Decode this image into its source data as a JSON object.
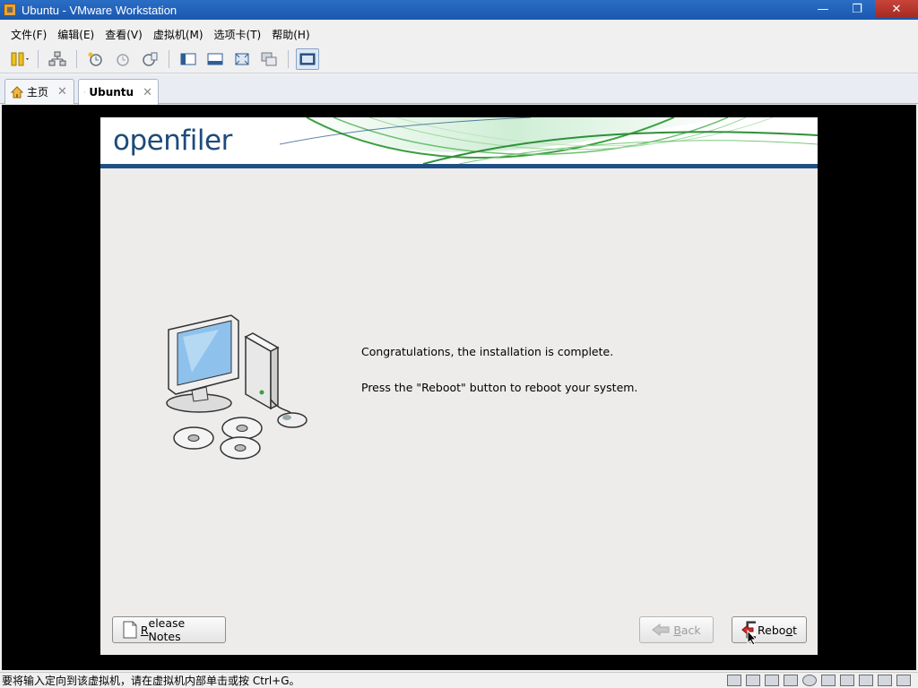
{
  "window": {
    "title": "Ubuntu - VMware Workstation",
    "controls": [
      "minimize-icon",
      "restore-icon",
      "close-icon"
    ]
  },
  "menu": [
    "文件(F)",
    "编辑(E)",
    "查看(V)",
    "虚拟机(M)",
    "选项卡(T)",
    "帮助(H)"
  ],
  "tabs": [
    {
      "label": "主页",
      "icon": "home-icon",
      "active": false
    },
    {
      "label": "Ubuntu",
      "icon": "vm-running-icon",
      "active": true
    }
  ],
  "installer": {
    "logo": "openfiler",
    "message_line1": "Congratulations, the installation is complete.",
    "message_line2": "Press the \"Reboot\" button to reboot your system.",
    "buttons": {
      "release_notes_mnemonic": "R",
      "release_notes_rest": "elease Notes",
      "back_mnemonic": "B",
      "back_rest": "ack",
      "reboot_prefix": "Rebo",
      "reboot_mnemonic": "o",
      "reboot_suffix": "t"
    }
  },
  "status": {
    "text": "要将输入定向到该虚拟机，请在虚拟机内部单击或按 Ctrl+G。"
  },
  "colors": {
    "titlebar": "#1b58b0",
    "banner_line": "#1f4f85",
    "logo": "#1d4b7a",
    "installer_bg": "#edeceb"
  }
}
